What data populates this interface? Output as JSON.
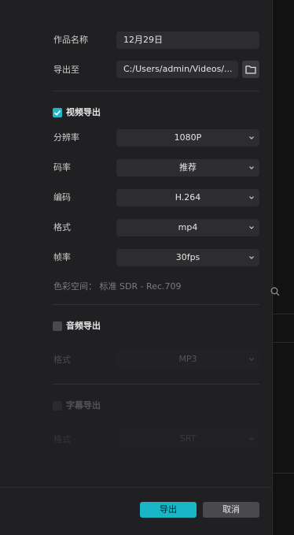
{
  "name_row": {
    "label": "作品名称",
    "value": "12月29日"
  },
  "path_row": {
    "label": "导出至",
    "value": "C:/Users/admin/Videos/..."
  },
  "video_section": {
    "checkbox_label": "视频导出",
    "checked": true,
    "rows": [
      {
        "label": "分辨率",
        "value": "1080P"
      },
      {
        "label": "码率",
        "value": "推荐"
      },
      {
        "label": "编码",
        "value": "H.264"
      },
      {
        "label": "格式",
        "value": "mp4"
      },
      {
        "label": "帧率",
        "value": "30fps"
      }
    ],
    "color_space": "色彩空间：  标准 SDR - Rec.709"
  },
  "audio_section": {
    "checkbox_label": "音频导出",
    "checked": false,
    "format_label": "格式",
    "format_value": "MP3"
  },
  "subtitle_section": {
    "checkbox_label": "字幕导出",
    "checked": false,
    "format_label": "格式",
    "format_value": "SRT"
  },
  "footer": {
    "export_label": "导出",
    "cancel_label": "取消"
  },
  "colors": {
    "accent": "#19b6c7",
    "panel": "#202022",
    "field": "#2d2d30"
  }
}
